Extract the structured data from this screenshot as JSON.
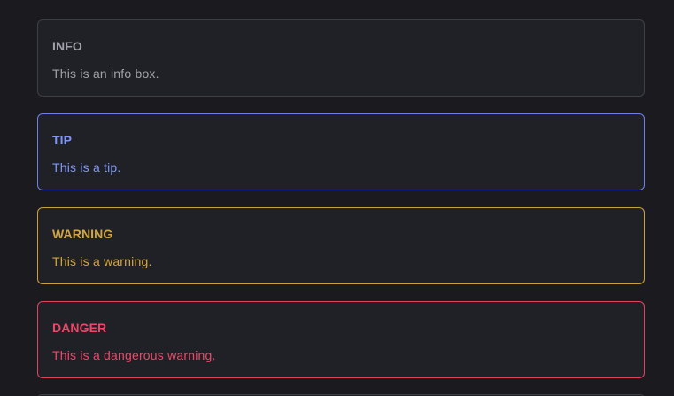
{
  "callouts": [
    {
      "title": "INFO",
      "text": "This is an info box."
    },
    {
      "title": "TIP",
      "text": "This is a tip."
    },
    {
      "title": "WARNING",
      "text": "This is a warning."
    },
    {
      "title": "DANGER",
      "text": "This is a dangerous warning."
    }
  ],
  "colors": {
    "background": "#1b1b1f",
    "info": "#a1a1a8",
    "tip": "#8096f0",
    "warning": "#d1a73d",
    "danger": "#ef4768"
  }
}
